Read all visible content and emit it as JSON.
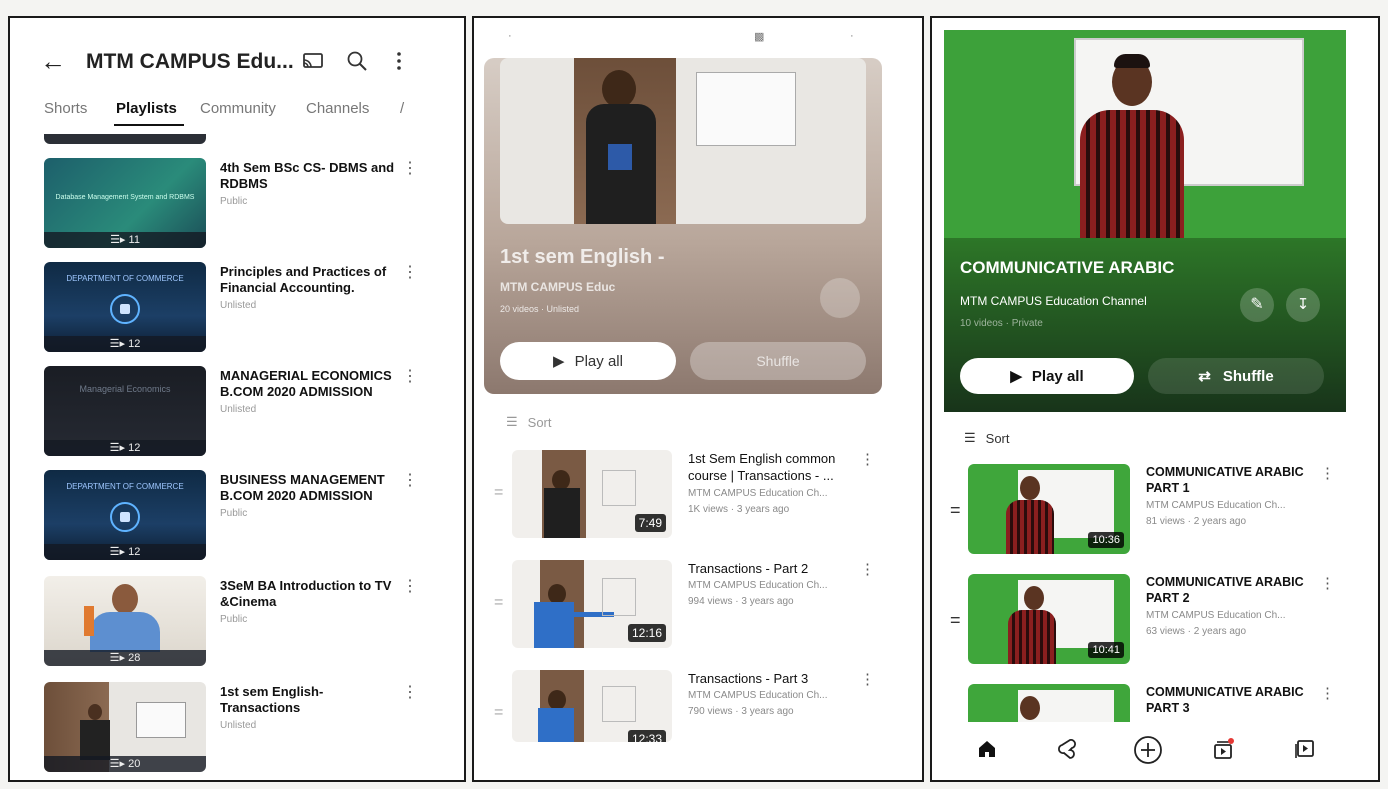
{
  "panel1": {
    "title": "MTM CAMPUS Edu...",
    "tabs": [
      "Shorts",
      "Playlists",
      "Community",
      "Channels",
      "/"
    ],
    "active_tab": "Playlists",
    "playlists": [
      {
        "title": "4th Sem BSc CS- DBMS and RDBMS",
        "visibility": "Public",
        "count": "11",
        "thumb_text": "Database Management System and RDBMS"
      },
      {
        "title": "Principles and Practices of Financial Accounting.",
        "visibility": "Unlisted",
        "count": "12",
        "thumb_text": "DEPARTMENT OF COMMERCE"
      },
      {
        "title": "MANAGERIAL ECONOMICS B.COM 2020 ADMISSION",
        "visibility": "Unlisted",
        "count": "12",
        "thumb_text": "Managerial Economics"
      },
      {
        "title": "BUSINESS MANAGEMENT B.COM 2020 ADMISSION",
        "visibility": "Public",
        "count": "12",
        "thumb_text": "DEPARTMENT OF COMMERCE"
      },
      {
        "title": "3SeM BA Introduction to TV &Cinema",
        "visibility": "Public",
        "count": "28",
        "thumb_text": ""
      },
      {
        "title": "1st sem English-Transactions",
        "visibility": "Unlisted",
        "count": "20",
        "thumb_text": ""
      }
    ]
  },
  "panel2": {
    "playlist_title": "1st sem English -",
    "channel": "MTM CAMPUS Educ",
    "meta": "20 videos · Unlisted",
    "play_all": "Play all",
    "shuffle": "Shuffle",
    "sort": "Sort",
    "videos": [
      {
        "title": "1st Sem English common course | Transactions - ...",
        "channel": "MTM CAMPUS Education Ch...",
        "meta": "1K views · 3 years ago",
        "duration": "7:49"
      },
      {
        "title": "Transactions - Part 2",
        "channel": "MTM CAMPUS Education Ch...",
        "meta": "994 views · 3 years ago",
        "duration": "12:16"
      },
      {
        "title": "Transactions - Part 3",
        "channel": "MTM CAMPUS Education Ch...",
        "meta": "790 views · 3 years ago",
        "duration": "12:33"
      }
    ]
  },
  "panel3": {
    "playlist_title": "COMMUNICATIVE ARABIC",
    "channel": "MTM CAMPUS Education Channel",
    "meta": "10 videos · Private",
    "play_all": "Play all",
    "shuffle": "Shuffle",
    "sort": "Sort",
    "videos": [
      {
        "title": "COMMUNICATIVE ARABIC PART 1",
        "channel": "MTM CAMPUS Education Ch...",
        "meta": "81 views · 2 years ago",
        "duration": "10:36"
      },
      {
        "title": "COMMUNICATIVE ARABIC PART 2",
        "channel": "MTM CAMPUS Education Ch...",
        "meta": "63 views · 2 years ago",
        "duration": "10:41"
      },
      {
        "title": "COMMUNICATIVE ARABIC PART 3",
        "channel": "",
        "meta": "",
        "duration": ""
      }
    ],
    "nav_icons": [
      "home-icon",
      "shorts-icon",
      "create-icon",
      "subscriptions-icon",
      "library-icon"
    ]
  },
  "colors": {
    "green_screen": "#3da13a",
    "dark_badge": "#141923",
    "commerce_blue": "#1c3f66",
    "notification_red": "#e53935"
  }
}
